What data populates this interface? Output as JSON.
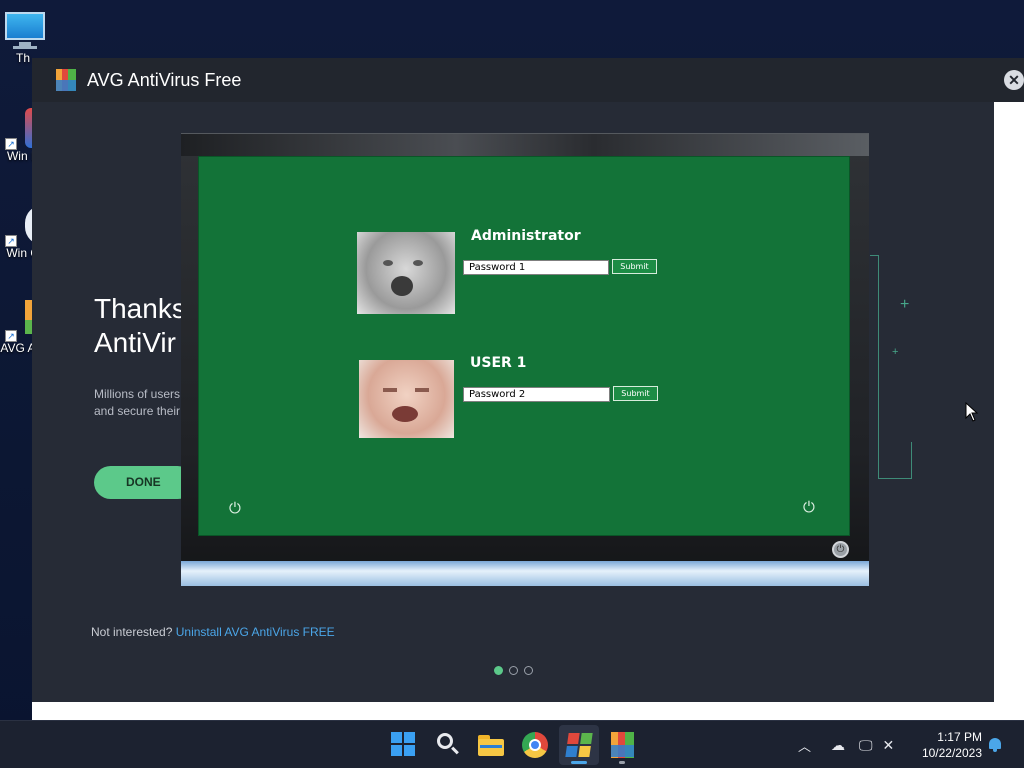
{
  "desktop": {
    "icons": [
      {
        "label": "Th",
        "icon": "monitor-icon"
      },
      {
        "label": "Win E",
        "icon": "edge-icon"
      },
      {
        "label": "Win O",
        "icon": "office-icon"
      },
      {
        "label": "AVG A F",
        "icon": "avg-icon"
      }
    ]
  },
  "window": {
    "title": "AVG AntiVirus Free",
    "close_label": "✕",
    "heading_line1": "Thanks",
    "heading_line2": "AntiVir",
    "subtext_line1": "Millions of users",
    "subtext_line2": "and secure their",
    "done_button": "DONE",
    "footer_prefix": "Not interested?",
    "footer_link": "Uninstall AVG AntiVirus FREE",
    "page_dots": 3,
    "active_dot": 0
  },
  "lock_screen": {
    "users": [
      {
        "name": "Administrator",
        "password_value": "Password 1",
        "submit": "Submit"
      },
      {
        "name": "USER 1",
        "password_value": "Password 2",
        "submit": "Submit"
      }
    ],
    "colors": {
      "background": "#137338",
      "accent": "#1c8c45"
    }
  },
  "taskbar": {
    "apps": [
      "start-icon",
      "search-icon",
      "file-explorer-icon",
      "chrome-icon",
      "windows7-app-icon",
      "avg-taskbar-icon"
    ],
    "tray": [
      "chevron-up-icon",
      "onedrive-icon",
      "display-icon",
      "network-off-icon"
    ],
    "time": "1:17 PM",
    "date": "10/22/2023"
  }
}
